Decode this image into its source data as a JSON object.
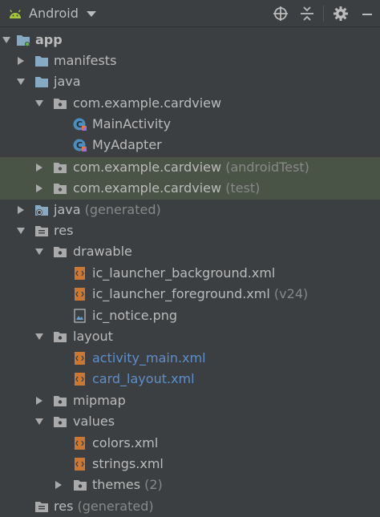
{
  "toolbar": {
    "view_name": "Android",
    "icons": [
      "android-icon",
      "chevron-down-icon",
      "crosshair-icon",
      "collapse-all-icon",
      "gear-icon",
      "minimize-icon"
    ]
  },
  "tree": {
    "app": "app",
    "manifests": "manifests",
    "java": "java",
    "pkg_main": "com.example.cardview",
    "main_activity": "MainActivity",
    "my_adapter": "MyAdapter",
    "pkg_android_test": "com.example.cardview",
    "pkg_android_test_hint": "(androidTest)",
    "pkg_test": "com.example.cardview",
    "pkg_test_hint": "(test)",
    "java_generated": "java",
    "java_generated_hint": "(generated)",
    "res": "res",
    "drawable": "drawable",
    "ic_launcher_background": "ic_launcher_background.xml",
    "ic_launcher_foreground": "ic_launcher_foreground.xml",
    "ic_launcher_foreground_hint": "(v24)",
    "ic_notice": "ic_notice.png",
    "layout": "layout",
    "activity_main": "activity_main.xml",
    "card_layout": "card_layout.xml",
    "mipmap": "mipmap",
    "values": "values",
    "colors": "colors.xml",
    "strings": "strings.xml",
    "themes": "themes",
    "themes_hint": "(2)",
    "res_generated": "res",
    "res_generated_hint": "(generated)"
  },
  "colors": {
    "background": "#3c3f41",
    "text": "#bbbbbb",
    "hint": "#888888",
    "modified_file": "#5c8fcc",
    "selection": "#4a5446",
    "folder": "#87aac4",
    "android_green": "#a4c639"
  }
}
